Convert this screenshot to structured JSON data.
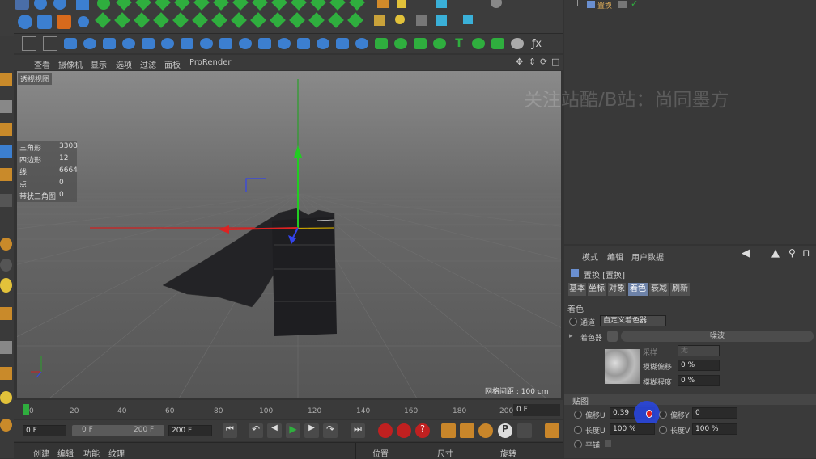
{
  "view_menu": [
    "查看",
    "摄像机",
    "显示",
    "选项",
    "过滤",
    "面板",
    "ProRender"
  ],
  "viewport": {
    "label": "透视视图",
    "stats": [
      {
        "k": "三角形",
        "v": "3308"
      },
      {
        "k": "四边形",
        "v": "12"
      },
      {
        "k": "线",
        "v": "6664"
      },
      {
        "k": "点",
        "v": "0"
      },
      {
        "k": "带状三角图",
        "v": "0"
      }
    ],
    "grid_info": "网格间距 : 100 cm",
    "watermark": "关注站酷/B站：尚同墨方"
  },
  "timeline": {
    "ticks": [
      "0",
      "20",
      "40",
      "60",
      "80",
      "100",
      "120",
      "140",
      "160",
      "180",
      "200"
    ],
    "frame_field": "0 F"
  },
  "transport": {
    "start": "0 F",
    "range_start": "0 F",
    "range_end": "200 F",
    "end": "200 F"
  },
  "bottom_menu": [
    "创建",
    "编辑",
    "功能",
    "纹理"
  ],
  "coord_labels": [
    "位置",
    "尺寸",
    "旋转"
  ],
  "object_manager": {
    "object_name": "置换"
  },
  "attr": {
    "menu": [
      "模式",
      "编辑",
      "用户数据"
    ],
    "title": "置换 [置换]",
    "tabs": [
      "基本",
      "坐标",
      "对象",
      "着色",
      "衰减",
      "刷新"
    ],
    "section": "着色",
    "channel_label": "通道",
    "channel_value": "自定义着色器",
    "shader_label": "着色器",
    "shader_value": "噪波",
    "sampling_label": "采样",
    "sampling_value": "无",
    "blur_offset_label": "模糊偏移",
    "blur_offset_value": "0 %",
    "blur_scale_label": "模糊程度",
    "blur_scale_value": "0 %",
    "map_section": "贴图",
    "offsetU_label": "偏移U",
    "offsetU_value": "0.39",
    "offsetV_label": "偏移Y",
    "offsetV_value": "0",
    "lengthU_label": "长度U",
    "lengthU_value": "100 %",
    "lengthV_label": "长度V",
    "lengthV_value": "100 %",
    "tile_label": "平铺"
  },
  "colors": {
    "accent_tab": "#6d82a8",
    "highlight": "#2f4fd6",
    "marker": "#e02020"
  }
}
